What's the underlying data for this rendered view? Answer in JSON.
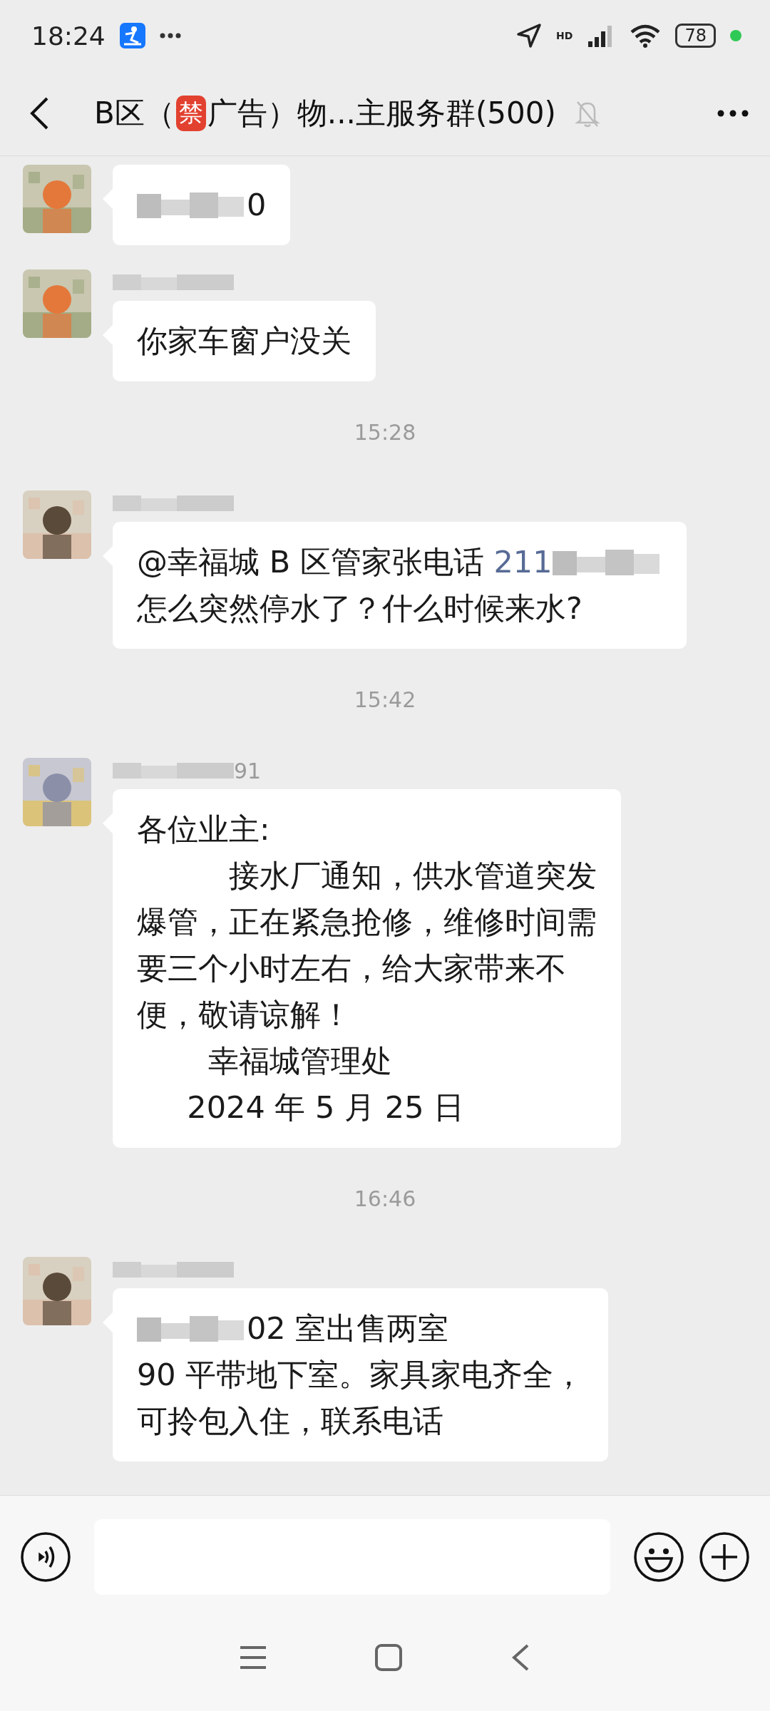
{
  "status_bar": {
    "time": "18:24",
    "signal_label": "HD",
    "battery": "78"
  },
  "header": {
    "title_start": "B区（",
    "badge": "禁",
    "title_end": "广告）物...主服务群(500)"
  },
  "chat": [
    {
      "kind": "message",
      "show_name": false,
      "lines": [
        [
          {
            "kind": "blur"
          },
          {
            "kind": "text",
            "text": "0"
          }
        ]
      ]
    },
    {
      "kind": "message",
      "show_name": true,
      "lines": [
        [
          {
            "kind": "text",
            "text": "你家车窗户没关"
          }
        ]
      ]
    },
    {
      "kind": "time",
      "text": "15:28"
    },
    {
      "kind": "message",
      "show_name": true,
      "lines": [
        [
          {
            "kind": "text",
            "text": "@幸福城 B 区管家张电话 "
          },
          {
            "kind": "number",
            "text": "211"
          },
          {
            "kind": "blur"
          }
        ],
        [
          {
            "kind": "text",
            "text": "怎么突然停水了？什么时候来水?"
          }
        ]
      ]
    },
    {
      "kind": "time",
      "text": "15:42"
    },
    {
      "kind": "message",
      "show_name": true,
      "name_end": "91",
      "lines": [
        [
          {
            "kind": "text",
            "text": "各位业主:"
          }
        ],
        [
          {
            "kind": "text",
            "text": "　　　接水厂通知，供水管道突发"
          }
        ],
        [
          {
            "kind": "text",
            "text": "爆管，正在紧急抢修，维修时间需"
          }
        ],
        [
          {
            "kind": "text",
            "text": "要三个小时左右，给大家带来不"
          }
        ],
        [
          {
            "kind": "text",
            "text": "便，敬请谅解！"
          }
        ],
        [
          {
            "kind": "text",
            "text": "　　 幸福城管理处"
          }
        ],
        [
          {
            "kind": "text",
            "text": "　  2024 年 5 月 25 日"
          }
        ]
      ]
    },
    {
      "kind": "time",
      "text": "16:46"
    },
    {
      "kind": "message",
      "show_name": true,
      "lines": [
        [
          {
            "kind": "blur"
          },
          {
            "kind": "text",
            "text": "02 室出售两室"
          }
        ],
        [
          {
            "kind": "text",
            "text": "90 平带地下室。家具家电齐全，"
          }
        ],
        [
          {
            "kind": "text",
            "text": "可拎包入住，联系电话"
          }
        ]
      ]
    }
  ]
}
